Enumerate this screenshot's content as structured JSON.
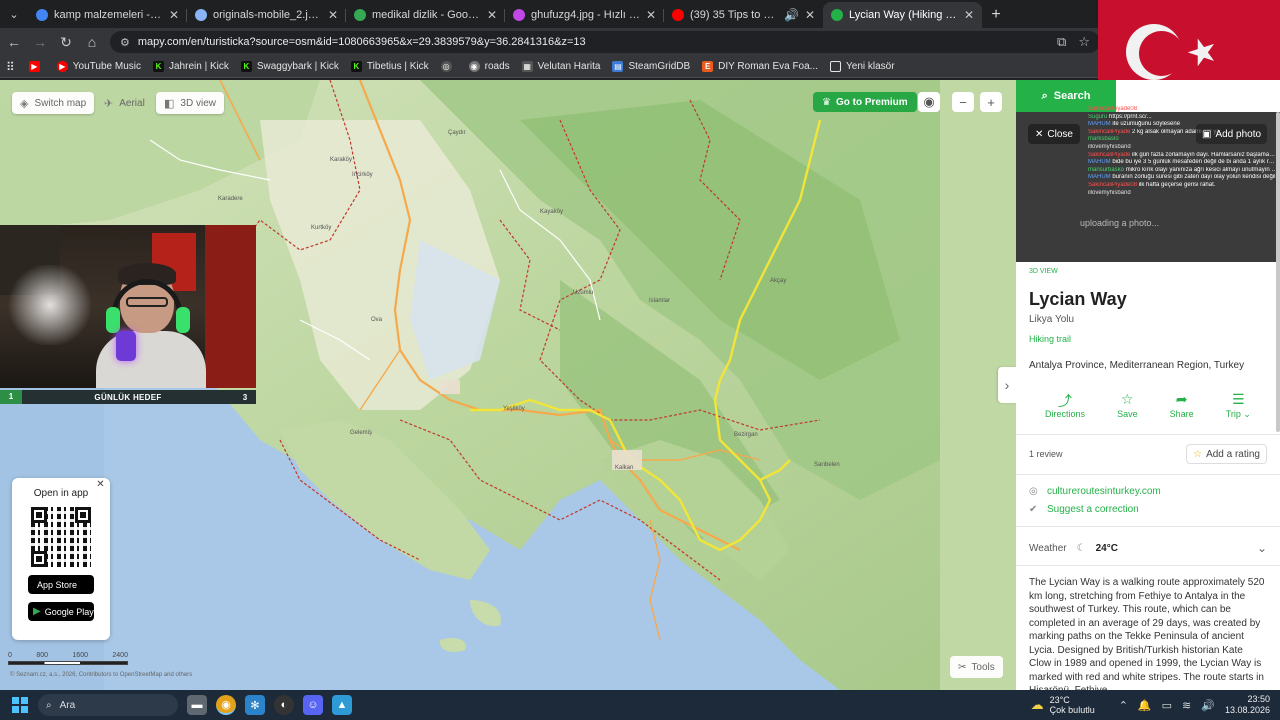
{
  "browser": {
    "tabs": [
      {
        "title": "kamp malzemeleri - Google'da",
        "favicon": "#4285f4"
      },
      {
        "title": "originals-mobile_2.jpg (1000×)",
        "favicon": "#8ab4f8"
      },
      {
        "title": "medikal dizlik - Google Alışver",
        "favicon": "#34a853"
      },
      {
        "title": "ghufuzg4.jpg - Hızlı Resim",
        "favicon": "#c147e9"
      },
      {
        "title": "(39) 35 Tips to Lighten Your",
        "favicon": "#ff0000"
      },
      {
        "title": "Lycian Way (Hiking trail) • Map",
        "favicon": "#24b148"
      }
    ],
    "address": "mapy.com/en/turisticka?source=osm&id=1080663965&x=29.3839579&y=36.2841316&z=13",
    "bookmarks": [
      {
        "label": "",
        "color": "#ff0000",
        "glyph": "▶"
      },
      {
        "label": "YouTube Music",
        "color": "#ff0000",
        "glyph": "▶"
      },
      {
        "label": "Jahrein | Kick",
        "color": "#53fc18",
        "glyph": "K"
      },
      {
        "label": "Swaggybark | Kick",
        "color": "#53fc18",
        "glyph": "K"
      },
      {
        "label": "Tibetius | Kick",
        "color": "#53fc18",
        "glyph": "K"
      },
      {
        "label": "",
        "color": "#bbbbbb",
        "glyph": "◎"
      },
      {
        "label": "roads",
        "color": "#bbbbbb",
        "glyph": "◉"
      },
      {
        "label": "Velutan Harita",
        "color": "#888888",
        "glyph": "▦"
      },
      {
        "label": "SteamGridDB",
        "color": "#3a7bd5",
        "glyph": "▤"
      },
      {
        "label": "DIY Roman Eva Foa...",
        "color": "#e85d1f",
        "glyph": "E"
      },
      {
        "label": "Yeni klasör",
        "color": "#e3e3e3",
        "glyph": "▭"
      }
    ]
  },
  "map": {
    "controls": {
      "switch_map": "Switch map",
      "aerial": "Aerial",
      "view3d": "3D view",
      "premium": "Go to Premium",
      "zoom_out": "−",
      "zoom_in": "+",
      "tools": "Tools"
    },
    "places": [
      {
        "name": "Çaydır"
      },
      {
        "name": "Karaköy"
      },
      {
        "name": "Incirköy"
      },
      {
        "name": "Karadere"
      },
      {
        "name": "Kurtköy"
      },
      {
        "name": "Kayaköy"
      },
      {
        "name": "Ova"
      },
      {
        "name": "Uzumlu"
      },
      {
        "name": "Islamlar"
      },
      {
        "name": "Akçay"
      },
      {
        "name": "Yeşilköy"
      },
      {
        "name": "Gelemiş"
      },
      {
        "name": "Kalkan"
      },
      {
        "name": "Bezirgan"
      },
      {
        "name": "Sarıbelen"
      },
      {
        "name": "Yeşilköy"
      }
    ],
    "scale": {
      "ticks": [
        "0",
        "800",
        "1600",
        "2400"
      ],
      "unit": "m"
    },
    "attribution": "© Seznam.cz, a.s., 2026, Contributors to OpenStreetMap and others"
  },
  "open_in_app": {
    "title": "Open in app",
    "app_store": "App Store",
    "google_play": "Google Play"
  },
  "stream": {
    "goal_left": "1",
    "goal_title": "GÜNLÜK HEDEF",
    "goal_right": "3"
  },
  "panel": {
    "search_label": "Search",
    "close_label": "Close",
    "add_photo_label": "Add photo",
    "photo_placeholder": "uploading a photo...",
    "chat": [
      {
        "user": "SakincaliPiyade08",
        "msg": "Yürüyüş ölcüye baktın sadece",
        "cls": "u1"
      },
      {
        "user": "Suguru",
        "msg": "https://prnt.sc/...",
        "cls": "u2"
      },
      {
        "user": "MAHUM",
        "msg": "ite uzunluğunu söylesene",
        "cls": "u3"
      },
      {
        "user": "SakincaliPiyade",
        "msg": "2 kg alsak olmayan adamı s2r ya",
        "cls": "u1"
      },
      {
        "user": "marksbaslo",
        "msg": "",
        "cls": "u2"
      },
      {
        "user": "illovemyhisband",
        "msg": "",
        "cls": "u4"
      },
      {
        "user": "SakincaliPiyade",
        "msg": "ilk gün fazla zorlamayın dayı. Hamlarsanız başlamadan biter yürüyüş",
        "cls": "u1"
      },
      {
        "user": "MAHUM",
        "msg": "bide bu iye 3 5 günlük mesafeden değil de bi anda 1 aylık rotadan başlamak",
        "cls": "u3"
      },
      {
        "user": "mansurbasko",
        "msg": "mikro kırık olayı yanınıza ağrı kesici almayı unutmayın dayı",
        "cls": "u2"
      },
      {
        "user": "MAHUM",
        "msg": "buranın zorluğu süresi gibi zaten dayı olay yolun kendisi değil",
        "cls": "u3"
      },
      {
        "user": "SakincaliPiyade08",
        "msg": "ilk hafta geçerse gerisi rahat.",
        "cls": "u1"
      },
      {
        "user": "illovemyhisband",
        "msg": "",
        "cls": "u4"
      }
    ],
    "view3d": "3D VIEW",
    "title": "Lycian Way",
    "subtitle": "Likya Yolu",
    "type": "Hiking trail",
    "region": "Antalya Province, Mediterranean Region, Turkey",
    "actions": [
      {
        "label": "Directions",
        "icon": "directions-icon",
        "glyph": "⤴"
      },
      {
        "label": "Save",
        "icon": "star-icon",
        "glyph": "☆"
      },
      {
        "label": "Share",
        "icon": "share-icon",
        "glyph": "➦"
      },
      {
        "label": "Trip",
        "icon": "trip-icon",
        "glyph": "⛿"
      }
    ],
    "reviews": "1 review",
    "add_rating": "Add a rating",
    "website": "cultureroutesinturkey.com",
    "suggest": "Suggest a correction",
    "weather_label": "Weather",
    "weather_temp": "24°C",
    "description": "The Lycian Way is a walking route approximately 520 km long, stretching from Fethiye to Antalya in the southwest of Turkey. This route, which can be completed in an average of 29 days, was created by marking paths on the Tekke Peninsula of ancient Lycia. Designed by British/Turkish historian Kate Clow in 1989 and opened in 1999, the Lycian Way is marked with red and white stripes. The route starts in Hisarönü, Fethiye"
  },
  "taskbar": {
    "search": "Ara",
    "weather_temp": "23°C",
    "weather_desc": "Çok bulutlu",
    "time": "23:50",
    "date": "13.08.2026"
  },
  "colors": {
    "brand_green": "#24b148",
    "trail_yellow": "#f2e53a",
    "road_orange": "#f5a94c",
    "boundary_red": "#c0392b",
    "sea": "#a9c8e8"
  }
}
